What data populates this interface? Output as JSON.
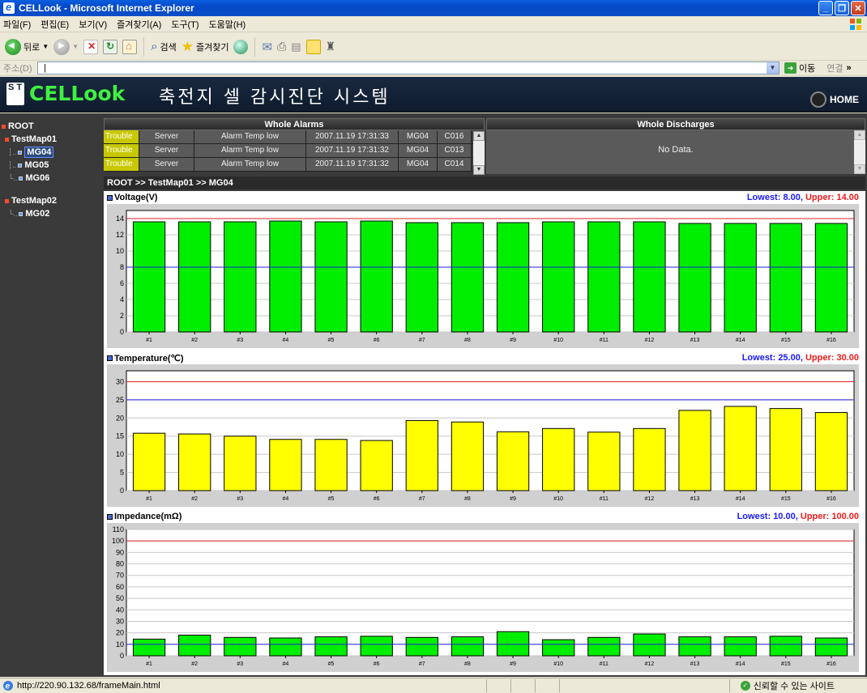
{
  "window": {
    "title": "CELLook - Microsoft Internet Explorer"
  },
  "menu": [
    "파일(F)",
    "편집(E)",
    "보기(V)",
    "즐겨찾기(A)",
    "도구(T)",
    "도움말(H)"
  ],
  "toolbar": {
    "back_label": "뒤로",
    "search_label": "검색",
    "favorites_label": "즐겨찾기"
  },
  "address": {
    "label": "주소(D)",
    "value": "",
    "go_label": "이동",
    "links_label": "연결"
  },
  "app": {
    "logo_text": "CELLook",
    "logo_mark": "S T",
    "title": "축전지 셀 감시진단 시스템",
    "home_label": "HOME"
  },
  "tree": {
    "root": "ROOT",
    "groups": [
      {
        "label": "TestMap01",
        "children": [
          "MG04",
          "MG05",
          "MG06"
        ]
      },
      {
        "label": "TestMap02",
        "children": [
          "MG02"
        ]
      }
    ]
  },
  "alarms": {
    "header": "Whole Alarms",
    "rows": [
      {
        "level": "Trouble",
        "source": "Server",
        "message": "Alarm Temp low",
        "time": "2007.11.19  17:31:33",
        "group": "MG04",
        "cell": "C016"
      },
      {
        "level": "Trouble",
        "source": "Server",
        "message": "Alarm Temp low",
        "time": "2007.11.19  17:31:32",
        "group": "MG04",
        "cell": "C013"
      },
      {
        "level": "Trouble",
        "source": "Server",
        "message": "Alarm Temp low",
        "time": "2007.11.19  17:31:32",
        "group": "MG04",
        "cell": "C014"
      }
    ]
  },
  "discharges": {
    "header": "Whole Discharges",
    "empty_text": "No Data."
  },
  "breadcrumb": "ROOT >> TestMap01 >> MG04",
  "chart_data": [
    {
      "type": "bar",
      "title": "Voltage(V)",
      "lowest_label": "Lowest: 8.00,",
      "upper_label": "Upper: 14.00",
      "categories": [
        "#1",
        "#2",
        "#3",
        "#4",
        "#5",
        "#6",
        "#7",
        "#8",
        "#9",
        "#10",
        "#11",
        "#12",
        "#13",
        "#14",
        "#15",
        "#16"
      ],
      "values": [
        13.6,
        13.6,
        13.6,
        13.7,
        13.6,
        13.7,
        13.5,
        13.5,
        13.5,
        13.6,
        13.6,
        13.6,
        13.4,
        13.4,
        13.4,
        13.4
      ],
      "ylim": [
        0,
        15
      ],
      "yticks": [
        0,
        2,
        4,
        6,
        8,
        10,
        12,
        14
      ],
      "lower_limit": 8,
      "upper_limit": 14,
      "bar_color": "#00ee00",
      "lower_color": "#2222dd",
      "upper_color": "#dd2222"
    },
    {
      "type": "bar",
      "title": "Temperature(℃)",
      "lowest_label": "Lowest: 25.00,",
      "upper_label": "Upper: 30.00",
      "categories": [
        "#1",
        "#2",
        "#3",
        "#4",
        "#5",
        "#6",
        "#7",
        "#8",
        "#9",
        "#10",
        "#11",
        "#12",
        "#13",
        "#14",
        "#15",
        "#16"
      ],
      "values": [
        15.8,
        15.6,
        15.0,
        14.1,
        14.1,
        13.8,
        19.3,
        18.9,
        16.2,
        17.1,
        16.1,
        17.1,
        22.1,
        23.2,
        22.6,
        21.5
      ],
      "ylim": [
        0,
        33
      ],
      "yticks": [
        0,
        5,
        10,
        15,
        20,
        25,
        30
      ],
      "lower_limit": 25,
      "upper_limit": 30,
      "bar_color": "#ffff00",
      "lower_color": "#2222dd",
      "upper_color": "#dd2222"
    },
    {
      "type": "bar",
      "title": "Impedance(mΩ)",
      "lowest_label": "Lowest: 10.00,",
      "upper_label": "Upper: 100.00",
      "categories": [
        "#1",
        "#2",
        "#3",
        "#4",
        "#5",
        "#6",
        "#7",
        "#8",
        "#9",
        "#10",
        "#11",
        "#12",
        "#13",
        "#14",
        "#15",
        "#16"
      ],
      "values": [
        14.5,
        18.0,
        16.0,
        15.5,
        16.5,
        17.0,
        16.0,
        16.5,
        21.0,
        14.0,
        16.0,
        19.0,
        16.5,
        16.5,
        17.0,
        15.5
      ],
      "ylim": [
        0,
        110
      ],
      "yticks": [
        0,
        10,
        20,
        30,
        40,
        50,
        60,
        70,
        80,
        90,
        100,
        110
      ],
      "lower_limit": 10,
      "upper_limit": 100,
      "bar_color": "#00ee00",
      "lower_color": "#2222dd",
      "upper_color": "#dd2222"
    }
  ],
  "status": {
    "url": "http://220.90.132.68/frameMain.html",
    "zone": "신뢰할 수 있는 사이트"
  }
}
